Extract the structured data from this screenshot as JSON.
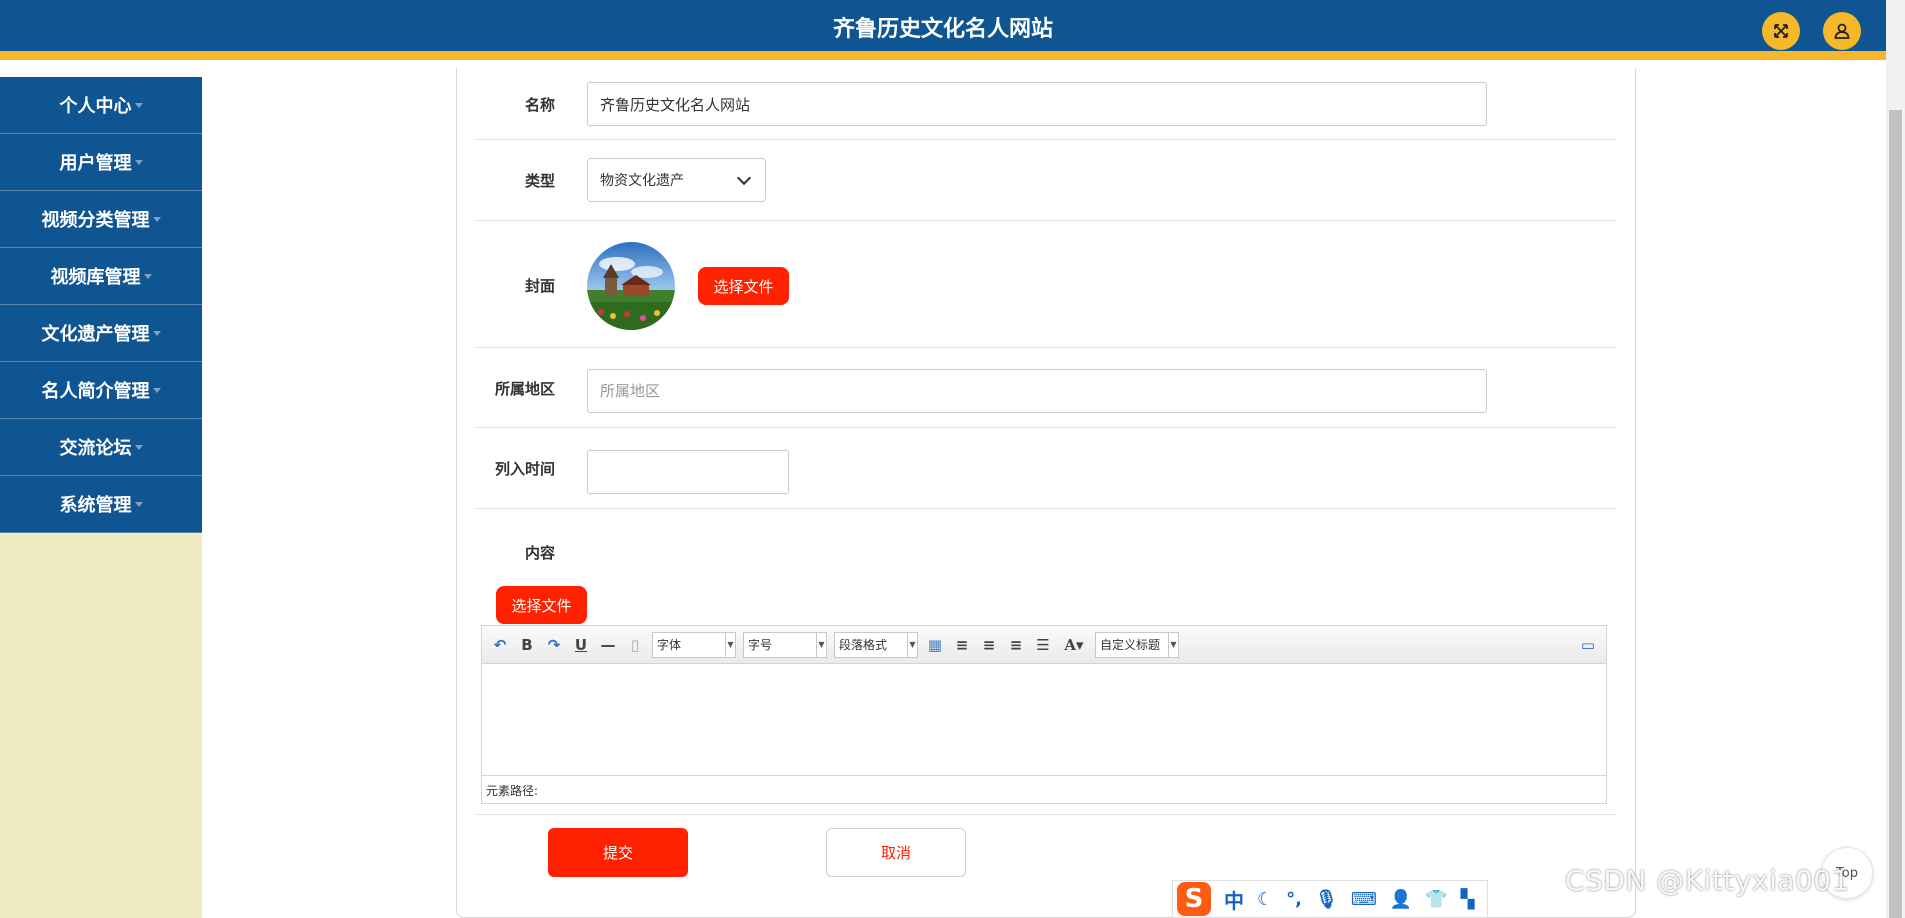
{
  "header": {
    "title": "齐鲁历史文化名人网站",
    "fullscreen_icon": "fullscreen-icon",
    "user_icon": "user-icon",
    "accent": "#f5b82a",
    "bg": "#0f5592"
  },
  "sidebar": {
    "items": [
      {
        "label": "个人中心"
      },
      {
        "label": "用户管理"
      },
      {
        "label": "视频分类管理"
      },
      {
        "label": "视频库管理"
      },
      {
        "label": "文化遗产管理"
      },
      {
        "label": "名人简介管理"
      },
      {
        "label": "交流论坛"
      },
      {
        "label": "系统管理"
      }
    ]
  },
  "form": {
    "name_label": "名称",
    "name_value": "齐鲁历史文化名人网站",
    "type_label": "类型",
    "type_value": "物资文化遗产",
    "cover_label": "封面",
    "cover_button": "选择文件",
    "region_label": "所属地区",
    "region_placeholder": "所属地区",
    "date_label": "列入时间",
    "date_value": "",
    "content_label": "内容",
    "content_button": "选择文件",
    "submit_label": "提交",
    "cancel_label": "取消"
  },
  "editor": {
    "font_family_label": "字体",
    "font_size_label": "字号",
    "paragraph_label": "段落格式",
    "custom_title_label": "自定义标题",
    "path_label": "元素路径:",
    "tools": [
      "undo-icon",
      "bold-icon",
      "redo-icon",
      "underline-icon",
      "horizontal-rule-icon",
      "paste-icon",
      "table-icon",
      "align-left-icon",
      "align-center-icon",
      "align-right-icon",
      "justify-icon",
      "font-color-icon",
      "fullscreen-icon"
    ]
  },
  "ime": {
    "logo": "S",
    "mode": "中",
    "icons": [
      "moon-icon",
      "punctuation-icon",
      "microphone-icon",
      "keyboard-icon",
      "person-icon",
      "skin-icon",
      "grid-icon"
    ]
  },
  "floating": {
    "top_label": "Top"
  },
  "watermark": "CSDN @Kittyxia001"
}
